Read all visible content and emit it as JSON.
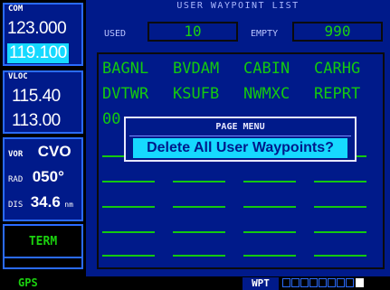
{
  "com": {
    "tag": "COM",
    "active": "123.000",
    "standby": "119.100"
  },
  "vloc": {
    "tag": "VLOC",
    "active": "115.40",
    "standby": "113.00"
  },
  "vor": {
    "tag": "VOR",
    "ident": "CVO",
    "rad_label": "RAD",
    "rad_value": "050°",
    "dis_label": "DIS",
    "dis_value": "34.6",
    "dis_unit": "nm"
  },
  "term": {
    "label": "TERM"
  },
  "main": {
    "title": "USER WAYPOINT LIST",
    "used_label": "USED",
    "used_value": "10",
    "empty_label": "EMPTY",
    "empty_value": "990",
    "waypoints": [
      "BAGNL",
      "BVDAM",
      "CABIN",
      "CARHG",
      "DVTWR",
      "KSUFB",
      "NWMXC",
      "REPRT",
      "00"
    ]
  },
  "popup": {
    "header": "PAGE MENU",
    "question": "Delete All User Waypoints?"
  },
  "status": {
    "gps": "GPS",
    "mode": "WPT"
  },
  "colors": {
    "panel": "#001a8a",
    "border": "#2a6bff",
    "green": "#1bd10f",
    "cyan": "#16d9ff"
  }
}
